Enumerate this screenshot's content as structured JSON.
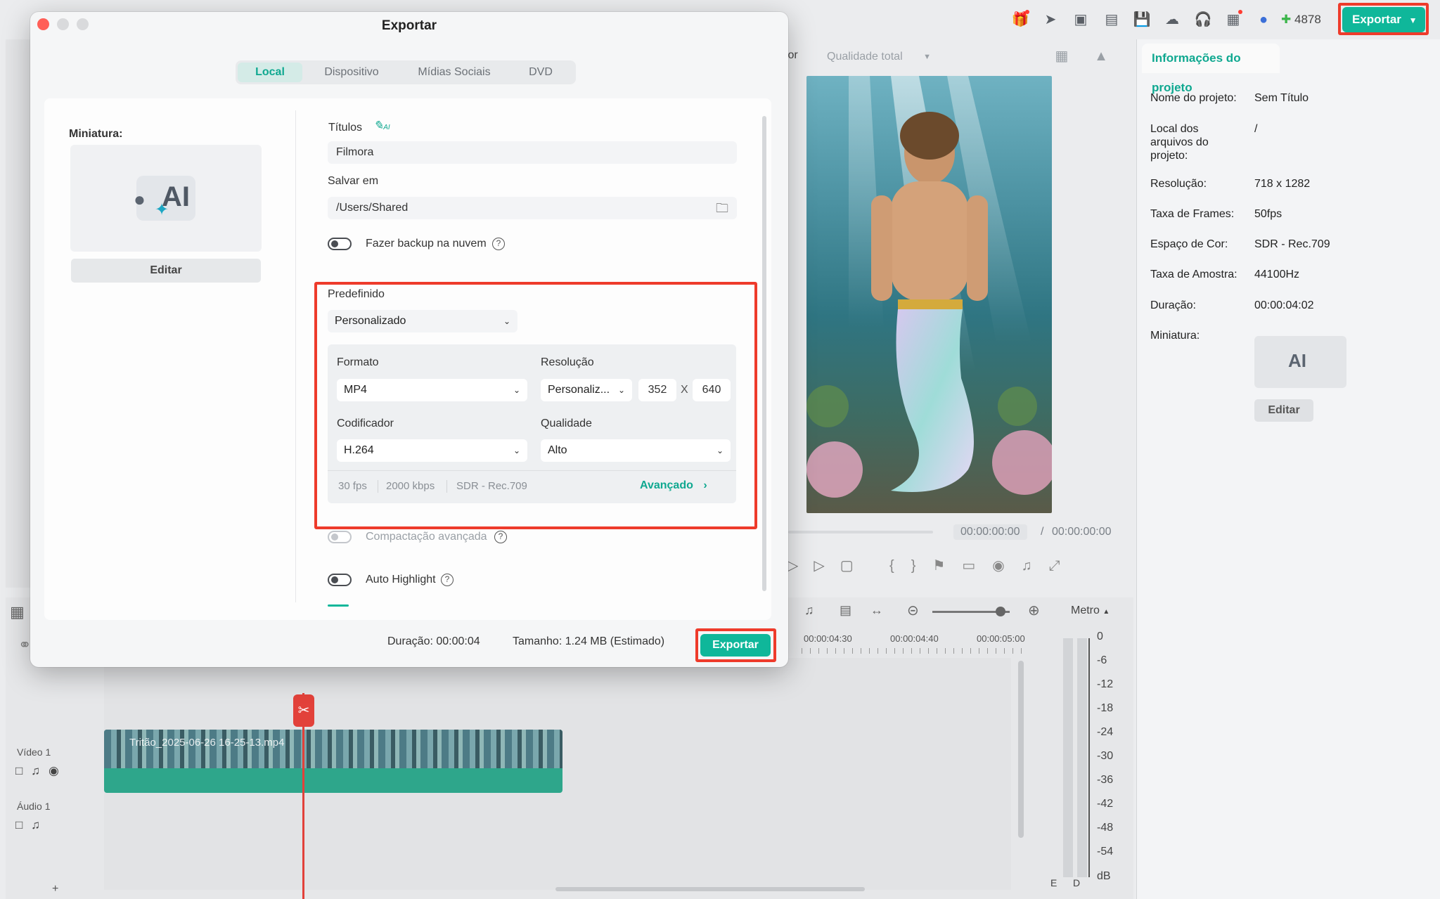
{
  "topbar": {
    "credits": "4878",
    "export_label": "Exportar",
    "colors": {
      "accent": "#0fb79a",
      "highlight": "#ee3b2b"
    }
  },
  "preview": {
    "partial_label": "tor",
    "quality_label": "Qualidade total",
    "time_current": "00:00:00:00",
    "time_sep": "/",
    "time_total": "00:00:00:00"
  },
  "info": {
    "tab": "Informações do projeto",
    "rows": [
      {
        "label": "Nome do projeto:",
        "value": "Sem Título"
      },
      {
        "label": "Local dos arquivos do projeto:",
        "value": "/"
      },
      {
        "label": "Resolução:",
        "value": "718 x 1282"
      },
      {
        "label": "Taxa de Frames:",
        "value": "50fps"
      },
      {
        "label": "Espaço de Cor:",
        "value": "SDR - Rec.709"
      },
      {
        "label": "Taxa de Amostra:",
        "value": "44100Hz"
      },
      {
        "label": "Duração:",
        "value": "00:00:04:02"
      },
      {
        "label": "Miniatura:",
        "value": ""
      }
    ],
    "thumb_text": "AI",
    "edit_label": "Editar"
  },
  "timeline": {
    "meter_mode": "Metro",
    "ruler": [
      "00:00:04:30",
      "00:00:04:40",
      "00:00:05:00"
    ],
    "video_track": "Vídeo 1",
    "audio_track": "Áudio 1",
    "clip_name": "Tritão_2025-06-26 16-25-13.mp4",
    "meter_scale": [
      "0",
      "-6",
      "-12",
      "-18",
      "-24",
      "-30",
      "-36",
      "-42",
      "-48",
      "-54",
      "dB"
    ],
    "meter_channels": [
      "E",
      "D"
    ],
    "add_track": "+"
  },
  "dialog": {
    "title": "Exportar",
    "tabs": [
      "Local",
      "Dispositivo",
      "Mídias Sociais",
      "DVD"
    ],
    "thumbnail_label": "Miniatura:",
    "thumbnail_text": "AI",
    "thumbnail_edit": "Editar",
    "titles_label": "Títulos",
    "titles_value": "Filmora",
    "save_label": "Salvar em",
    "save_value": "/Users/Shared",
    "backup_label": "Fazer backup na nuvem",
    "preset_label": "Predefinido",
    "preset_value": "Personalizado",
    "format_label": "Formato",
    "format_value": "MP4",
    "resolution_label": "Resolução",
    "resolution_value": "Personaliz...",
    "width": "352",
    "x_sep": "X",
    "height": "640",
    "encoder_label": "Codificador",
    "encoder_value": "H.264",
    "quality_label": "Qualidade",
    "quality_value": "Alto",
    "summary": [
      "30 fps",
      "2000 kbps",
      "SDR - Rec.709"
    ],
    "advanced_label": "Avançado",
    "compress_label": "Compactação avançada",
    "autohighlight_label": "Auto Highlight",
    "duration": "Duração: 00:00:04",
    "size": "Tamanho: 1.24 MB (Estimado)",
    "export_label": "Exportar"
  }
}
